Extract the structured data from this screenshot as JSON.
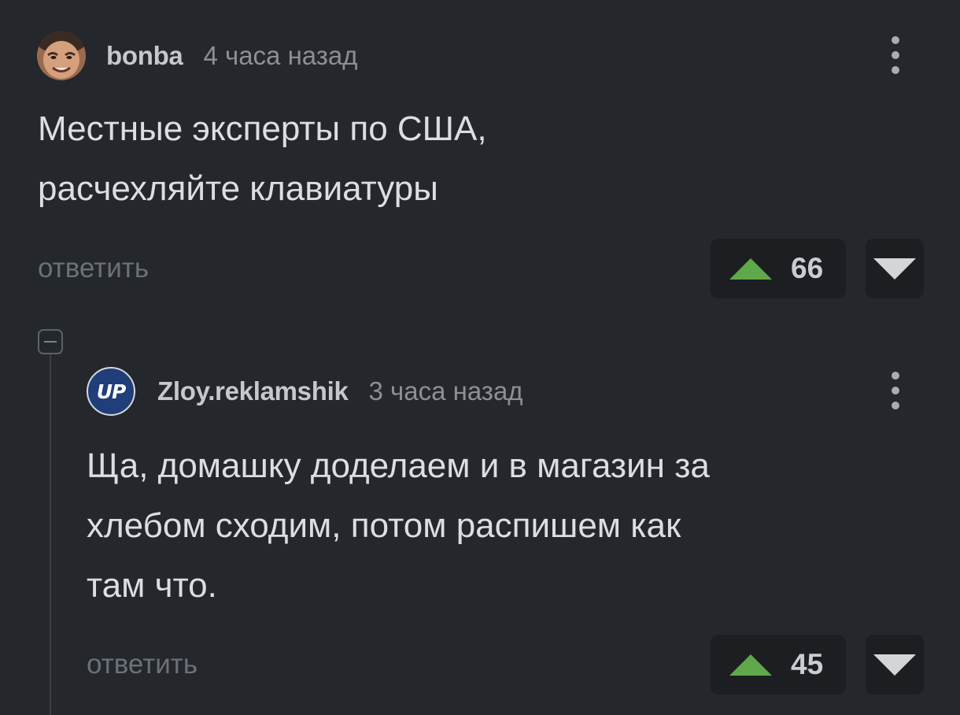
{
  "comments": [
    {
      "author": "bonba",
      "time": "4 часа назад",
      "text": "Местные эксперты по США,\nрасчехляйте клавиатуры",
      "reply_label": "ответить",
      "rating": "66"
    },
    {
      "author": "Zloy.reklamshik",
      "avatar_text": "UP",
      "time": "3 часа назад",
      "text": "Ща, домашку доделаем и в магазин за\nхлебом сходим, потом распишем как\nтам что.",
      "reply_label": "ответить",
      "rating": "45"
    }
  ],
  "icons": {
    "vote_up": "triangle-up-icon",
    "vote_down": "triangle-down-icon",
    "more": "vertical-dots-icon",
    "collapse": "minus-square-icon"
  },
  "colors": {
    "background": "#24272c",
    "upvote": "#5fa84b",
    "vote_button_bg": "#1c1e22"
  }
}
